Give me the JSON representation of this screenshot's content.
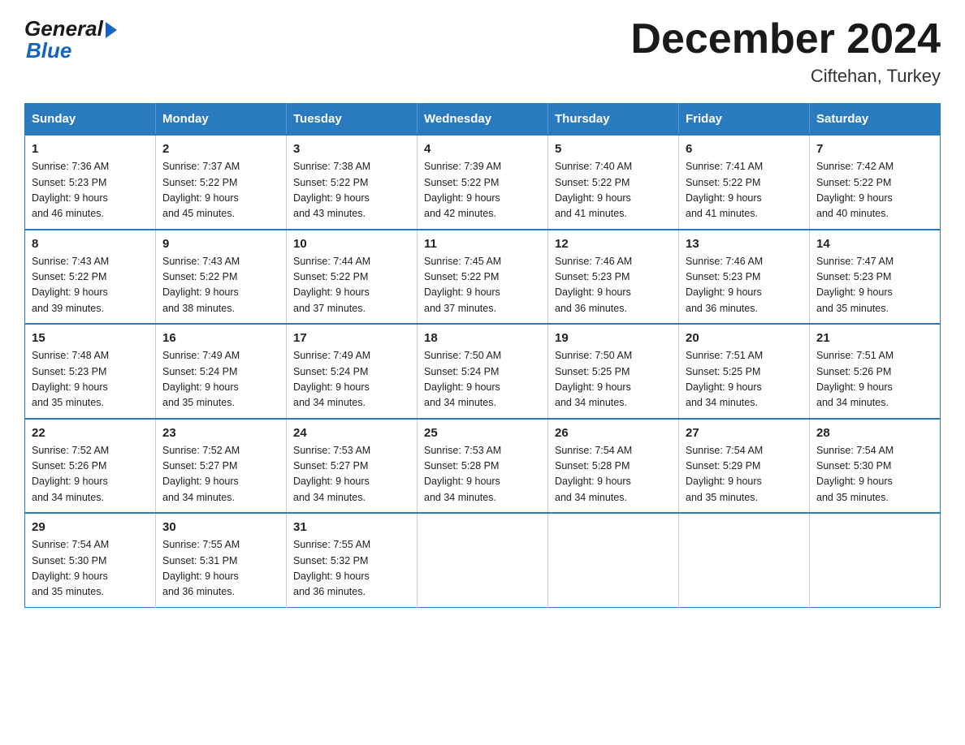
{
  "logo": {
    "general": "General",
    "blue": "Blue"
  },
  "title": "December 2024",
  "location": "Ciftehan, Turkey",
  "days_of_week": [
    "Sunday",
    "Monday",
    "Tuesday",
    "Wednesday",
    "Thursday",
    "Friday",
    "Saturday"
  ],
  "weeks": [
    [
      {
        "day": "1",
        "sunrise": "7:36 AM",
        "sunset": "5:23 PM",
        "daylight": "9 hours and 46 minutes."
      },
      {
        "day": "2",
        "sunrise": "7:37 AM",
        "sunset": "5:22 PM",
        "daylight": "9 hours and 45 minutes."
      },
      {
        "day": "3",
        "sunrise": "7:38 AM",
        "sunset": "5:22 PM",
        "daylight": "9 hours and 43 minutes."
      },
      {
        "day": "4",
        "sunrise": "7:39 AM",
        "sunset": "5:22 PM",
        "daylight": "9 hours and 42 minutes."
      },
      {
        "day": "5",
        "sunrise": "7:40 AM",
        "sunset": "5:22 PM",
        "daylight": "9 hours and 41 minutes."
      },
      {
        "day": "6",
        "sunrise": "7:41 AM",
        "sunset": "5:22 PM",
        "daylight": "9 hours and 41 minutes."
      },
      {
        "day": "7",
        "sunrise": "7:42 AM",
        "sunset": "5:22 PM",
        "daylight": "9 hours and 40 minutes."
      }
    ],
    [
      {
        "day": "8",
        "sunrise": "7:43 AM",
        "sunset": "5:22 PM",
        "daylight": "9 hours and 39 minutes."
      },
      {
        "day": "9",
        "sunrise": "7:43 AM",
        "sunset": "5:22 PM",
        "daylight": "9 hours and 38 minutes."
      },
      {
        "day": "10",
        "sunrise": "7:44 AM",
        "sunset": "5:22 PM",
        "daylight": "9 hours and 37 minutes."
      },
      {
        "day": "11",
        "sunrise": "7:45 AM",
        "sunset": "5:22 PM",
        "daylight": "9 hours and 37 minutes."
      },
      {
        "day": "12",
        "sunrise": "7:46 AM",
        "sunset": "5:23 PM",
        "daylight": "9 hours and 36 minutes."
      },
      {
        "day": "13",
        "sunrise": "7:46 AM",
        "sunset": "5:23 PM",
        "daylight": "9 hours and 36 minutes."
      },
      {
        "day": "14",
        "sunrise": "7:47 AM",
        "sunset": "5:23 PM",
        "daylight": "9 hours and 35 minutes."
      }
    ],
    [
      {
        "day": "15",
        "sunrise": "7:48 AM",
        "sunset": "5:23 PM",
        "daylight": "9 hours and 35 minutes."
      },
      {
        "day": "16",
        "sunrise": "7:49 AM",
        "sunset": "5:24 PM",
        "daylight": "9 hours and 35 minutes."
      },
      {
        "day": "17",
        "sunrise": "7:49 AM",
        "sunset": "5:24 PM",
        "daylight": "9 hours and 34 minutes."
      },
      {
        "day": "18",
        "sunrise": "7:50 AM",
        "sunset": "5:24 PM",
        "daylight": "9 hours and 34 minutes."
      },
      {
        "day": "19",
        "sunrise": "7:50 AM",
        "sunset": "5:25 PM",
        "daylight": "9 hours and 34 minutes."
      },
      {
        "day": "20",
        "sunrise": "7:51 AM",
        "sunset": "5:25 PM",
        "daylight": "9 hours and 34 minutes."
      },
      {
        "day": "21",
        "sunrise": "7:51 AM",
        "sunset": "5:26 PM",
        "daylight": "9 hours and 34 minutes."
      }
    ],
    [
      {
        "day": "22",
        "sunrise": "7:52 AM",
        "sunset": "5:26 PM",
        "daylight": "9 hours and 34 minutes."
      },
      {
        "day": "23",
        "sunrise": "7:52 AM",
        "sunset": "5:27 PM",
        "daylight": "9 hours and 34 minutes."
      },
      {
        "day": "24",
        "sunrise": "7:53 AM",
        "sunset": "5:27 PM",
        "daylight": "9 hours and 34 minutes."
      },
      {
        "day": "25",
        "sunrise": "7:53 AM",
        "sunset": "5:28 PM",
        "daylight": "9 hours and 34 minutes."
      },
      {
        "day": "26",
        "sunrise": "7:54 AM",
        "sunset": "5:28 PM",
        "daylight": "9 hours and 34 minutes."
      },
      {
        "day": "27",
        "sunrise": "7:54 AM",
        "sunset": "5:29 PM",
        "daylight": "9 hours and 35 minutes."
      },
      {
        "day": "28",
        "sunrise": "7:54 AM",
        "sunset": "5:30 PM",
        "daylight": "9 hours and 35 minutes."
      }
    ],
    [
      {
        "day": "29",
        "sunrise": "7:54 AM",
        "sunset": "5:30 PM",
        "daylight": "9 hours and 35 minutes."
      },
      {
        "day": "30",
        "sunrise": "7:55 AM",
        "sunset": "5:31 PM",
        "daylight": "9 hours and 36 minutes."
      },
      {
        "day": "31",
        "sunrise": "7:55 AM",
        "sunset": "5:32 PM",
        "daylight": "9 hours and 36 minutes."
      },
      null,
      null,
      null,
      null
    ]
  ],
  "labels": {
    "sunrise": "Sunrise:",
    "sunset": "Sunset:",
    "daylight": "Daylight:"
  }
}
